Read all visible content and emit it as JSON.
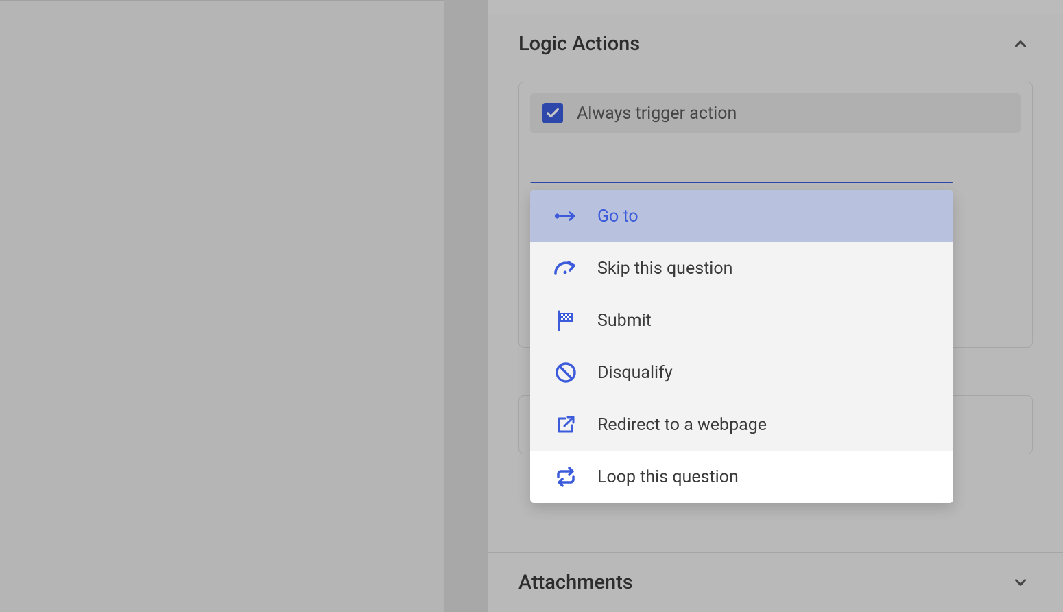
{
  "sections": {
    "logic_actions": {
      "title": "Logic Actions",
      "expanded": true,
      "checkbox": {
        "checked": true,
        "label": "Always trigger action"
      }
    },
    "attachments": {
      "title": "Attachments",
      "expanded": false
    }
  },
  "dropdown": {
    "items": [
      {
        "label": "Go to",
        "icon": "goto",
        "selected": true,
        "hovered": false
      },
      {
        "label": "Skip this question",
        "icon": "skip",
        "selected": false,
        "hovered": false
      },
      {
        "label": "Submit",
        "icon": "flag",
        "selected": false,
        "hovered": false
      },
      {
        "label": "Disqualify",
        "icon": "ban",
        "selected": false,
        "hovered": false
      },
      {
        "label": "Redirect to a webpage",
        "icon": "external",
        "selected": false,
        "hovered": false
      },
      {
        "label": "Loop this question",
        "icon": "loop",
        "selected": false,
        "hovered": true
      }
    ]
  }
}
